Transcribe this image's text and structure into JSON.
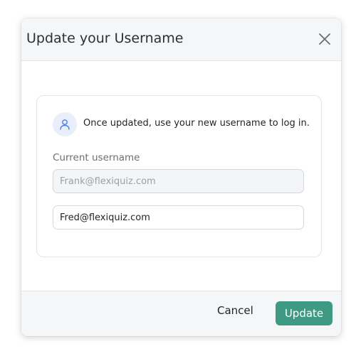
{
  "dialog": {
    "title": "Update your Username",
    "close_icon": "close-icon"
  },
  "notice": {
    "icon": "user-icon",
    "text": "Once updated, use your new username to log in."
  },
  "form": {
    "current_label": "Current username",
    "current_value": "Frank@flexiquiz.com",
    "new_value": "Fred@flexiquiz.com"
  },
  "footer": {
    "cancel_label": "Cancel",
    "update_label": "Update"
  },
  "colors": {
    "accent": "#3f9a83",
    "icon_blue": "#4f7de3",
    "icon_bg": "#e9eefb"
  }
}
